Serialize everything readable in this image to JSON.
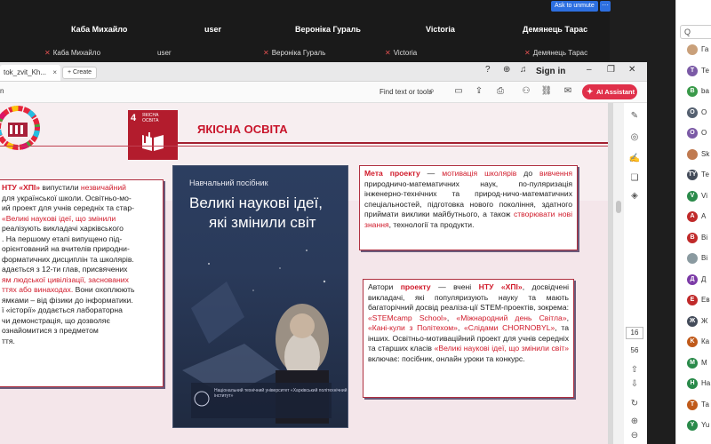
{
  "meeting": {
    "participants": [
      {
        "name": "",
        "tile_name": ""
      },
      {
        "name": "Каба Михайло",
        "tile_name": "Каба Михайло"
      },
      {
        "name": "user",
        "tile_name": "user"
      },
      {
        "name": "Вероніка Гураль",
        "tile_name": "Вероніка Гураль"
      },
      {
        "name": "Victoria",
        "tile_name": "Victoria"
      },
      {
        "name": "Демянець Тарас",
        "tile_name": "Демянець Тарас"
      }
    ],
    "unmute_label": "Ask to unmute",
    "more_label": "···"
  },
  "right_panel": {
    "search_prefix": "Q",
    "items": [
      {
        "initial": "",
        "text": "Га",
        "color": "#c9a07a"
      },
      {
        "initial": "T",
        "text": "Те",
        "color": "#7b5aa6"
      },
      {
        "initial": "B",
        "text": "ba",
        "color": "#3a9a4a"
      },
      {
        "initial": "O",
        "text": "О",
        "color": "#556070"
      },
      {
        "initial": "O",
        "text": "О",
        "color": "#7b5aa6"
      },
      {
        "initial": "",
        "text": "Sk",
        "color": "#c07a50"
      },
      {
        "initial": "TY",
        "text": "Те",
        "color": "#444c5a"
      },
      {
        "initial": "V",
        "text": "Vi",
        "color": "#2a8a4a"
      },
      {
        "initial": "A",
        "text": "А",
        "color": "#c02a2a"
      },
      {
        "initial": "B",
        "text": "Ві",
        "color": "#c02a2a"
      },
      {
        "initial": "",
        "text": "Ві",
        "color": "#8a9aa0"
      },
      {
        "initial": "Д",
        "text": "Д",
        "color": "#7b3aa6"
      },
      {
        "initial": "E",
        "text": "Ев",
        "color": "#c02a2a"
      },
      {
        "initial": "Ж",
        "text": "Ж",
        "color": "#444c5a"
      },
      {
        "initial": "K",
        "text": "Ка",
        "color": "#c05a1a"
      },
      {
        "initial": "M",
        "text": "М",
        "color": "#2a8a4a"
      },
      {
        "initial": "H",
        "text": "На",
        "color": "#2a8a4a"
      },
      {
        "initial": "T",
        "text": "Та",
        "color": "#c05a1a"
      },
      {
        "initial": "Y",
        "text": "Yu",
        "color": "#2a8a4a"
      }
    ]
  },
  "browser": {
    "tab_title": "tok_zvit_Kh...",
    "tab_close": "×",
    "create_label": "+ Create",
    "help_icon": "?",
    "sign_in": "Sign in",
    "left_crumb": "n",
    "find_label": "Find text or tools",
    "ai_label": "AI Assistant"
  },
  "slide": {
    "sdg_number": "4",
    "sdg_text": "ЯКІСНА ОСВІТА",
    "heading": "ЯКІСНА ОСВІТА",
    "book_subtitle": "Навчальний посібник",
    "book_title_1": "Великі наукові ідеї,",
    "book_title_2": "які змінили світ",
    "book_footer": "Національний технічний університет «Харківський політехнічний інститут»",
    "left_box": {
      "l1a": "НТУ «ХПІ»",
      "l1b": " випустили ",
      "l1c": "незвичайний",
      "l2": " для української школи. Освітньо-мо-",
      "l3": "ий проект для учнів середніх та стар-",
      "l4a": " ",
      "l4b": "«Великі наукові ідеї, що змінили",
      "l5": "реалізують викладачі харківського",
      "l6": ". На першому етапі випущено під-",
      "l7": "орієнтований на вчителів природни-",
      "l8": "форматичних дисциплін та школярів.",
      "l9": "адається з 12-ти глав, присвячених",
      "l10": "ям людської цивілізації, заснованих",
      "l11": "ттях або винаходах.",
      "l11b": " Вони охоплюють",
      "l12": "ямками – від фізики до інформатики.",
      "l13": "ї «історії» додається лабораторна",
      "l14": "чи демонстрація, що дозволяє",
      "l15": "ознайомитися з предметом",
      "l16": "ття."
    },
    "goal_box": {
      "a": "Мета проекту",
      "b": " — ",
      "c": "мотивація школярів",
      "d": " до ",
      "e": "вивчення",
      "f": " природничо-математичних наук, по-пуляризація інженерно-технічних та природ-ничо-математичних спеціальностей, підготовка нового покоління, здатного приймати виклики майбутнього, а також ",
      "g": "створювати нові знання",
      "h": ", технології та продукти."
    },
    "authors_box": {
      "a": "Автори ",
      "b": "проекту",
      "c": " — вчені ",
      "d": "НТУ «ХПІ»",
      "e": ", досвідчені викладачі, які популяризують науку та мають багаторічний досвід реаліза-ції STEM-проектів, зокрема: ",
      "f": "«STEMcamp School»",
      "g": ", ",
      "h": "«Міжнародний день Світла»",
      "i": ", ",
      "j": "«Кані-кули з Політехом»",
      "k": ", ",
      "l": "«Слідами CHORNOBYL»",
      "m": ", та інших. Освітньо-мотиваційний проект для учнів середніх та старших класів ",
      "n": "«Великі наукові ідеї, що змінили світ»",
      "o": " включає: посібник, онлайн уроки та конкурс."
    }
  },
  "viewer": {
    "page_current": "16",
    "page_total": "56"
  }
}
